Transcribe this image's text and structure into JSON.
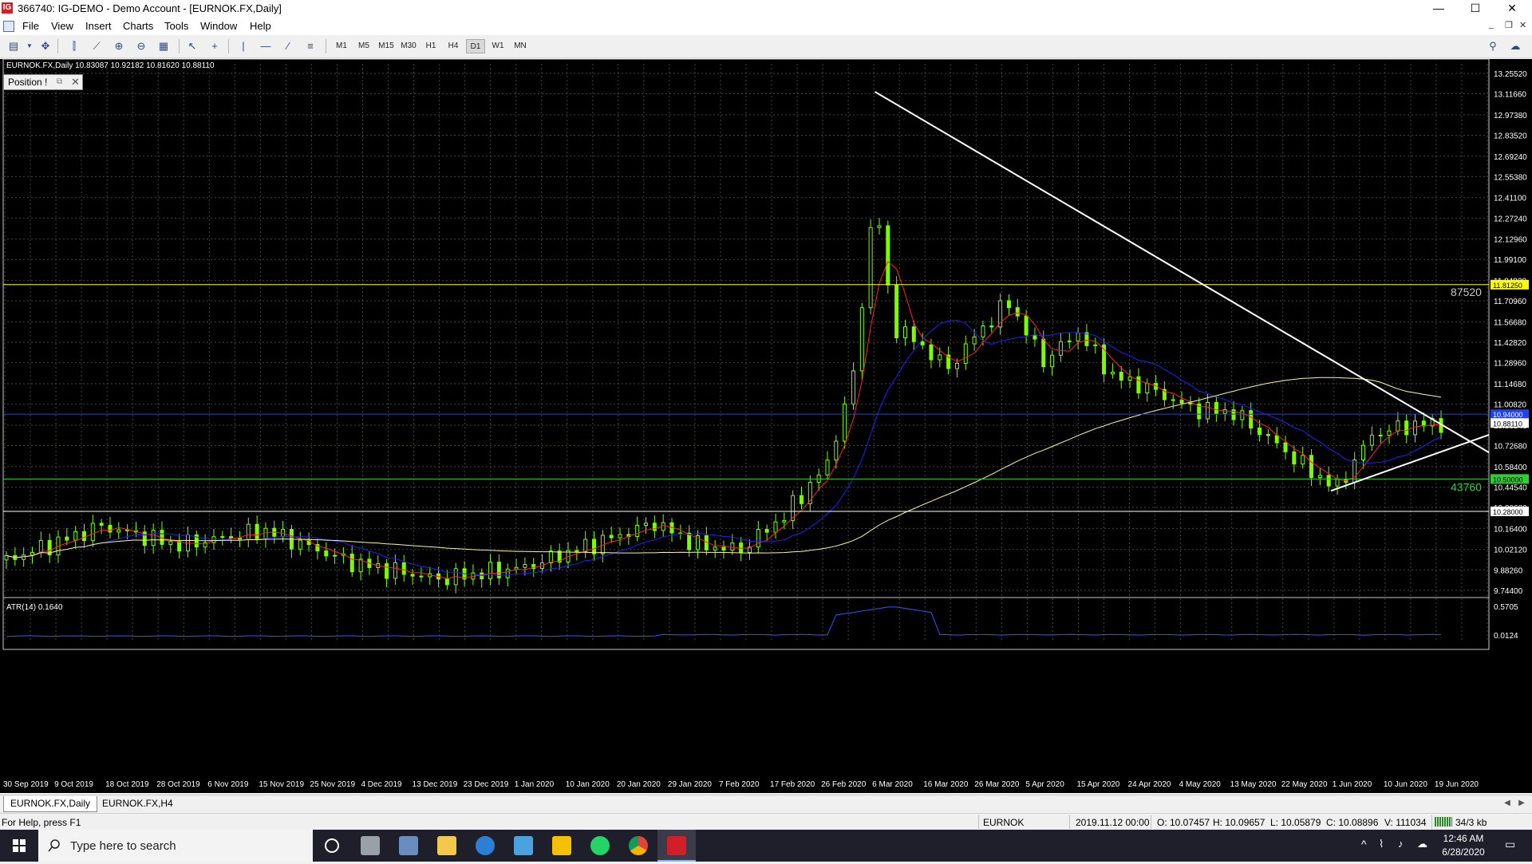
{
  "window": {
    "title": "366740: IG-DEMO - Demo Account - [EURNOK.FX,Daily]",
    "app_icon_text": "IG",
    "controls": {
      "minimize": "—",
      "maximize": "☐",
      "close": "✕"
    },
    "mdi_controls": {
      "minimize": "_",
      "restore": "❐",
      "close": "✕"
    }
  },
  "menu": [
    "File",
    "View",
    "Insert",
    "Charts",
    "Tools",
    "Window",
    "Help"
  ],
  "toolbar": {
    "timeframes": [
      "M1",
      "M5",
      "M15",
      "M30",
      "H1",
      "H4",
      "D1",
      "W1",
      "MN"
    ],
    "active_timeframe": "D1"
  },
  "chart": {
    "symbol_label": "EURNOK.FX,Daily  10.83087 10.92182 10.81620 10.88110",
    "position_panel_label": "Position !",
    "indicator_label": "ATR(14) 0.1640",
    "hline_labels": [
      "87520",
      "43760"
    ],
    "price_axis": [
      "13.25520",
      "13.11660",
      "12.97380",
      "12.83520",
      "12.69240",
      "12.55380",
      "12.41100",
      "12.27240",
      "12.12960",
      "11.99100",
      "11.84820",
      "11.70960",
      "11.56680",
      "11.42820",
      "11.28960",
      "11.14680",
      "11.00820",
      "10.86540",
      "10.72680",
      "10.58400",
      "10.44540",
      "10.30680",
      "10.16400",
      "10.02120",
      "9.88260",
      "9.74400"
    ],
    "price_badges": {
      "yellow": "11.81250",
      "current": "10.88110",
      "green": "10.50000",
      "white": "10.28000",
      "blue": "10.94000"
    },
    "atr_axis": [
      "0.5705",
      "0.0124"
    ],
    "date_axis": [
      "30 Sep 2019",
      "9 Oct 2019",
      "18 Oct 2019",
      "28 Oct 2019",
      "6 Nov 2019",
      "15 Nov 2019",
      "25 Nov 2019",
      "4 Dec 2019",
      "13 Dec 2019",
      "23 Dec 2019",
      "1 Jan 2020",
      "10 Jan 2020",
      "20 Jan 2020",
      "29 Jan 2020",
      "7 Feb 2020",
      "17 Feb 2020",
      "26 Feb 2020",
      "6 Mar 2020",
      "16 Mar 2020",
      "26 Mar 2020",
      "5 Apr 2020",
      "15 Apr 2020",
      "24 Apr 2020",
      "4 May 2020",
      "13 May 2020",
      "22 May 2020",
      "1 Jun 2020",
      "10 Jun 2020",
      "19 Jun 2020"
    ],
    "colors": {
      "background": "#000000",
      "candle": "#7cfc00",
      "grid": "#3a4a3a",
      "ma_red": "#ff2020",
      "ma_blue": "#2020ff",
      "ma_yellow": "#fff4a0",
      "trendline": "#ffffff",
      "hline_yellow": "#ffff00",
      "hline_green": "#32cd32",
      "hline_blue": "#1e40ff",
      "atr": "#3355ff"
    }
  },
  "tabs": [
    {
      "label": "EURNOK.FX,Daily",
      "active": true
    },
    {
      "label": "EURNOK.FX,H4",
      "active": false
    }
  ],
  "status": {
    "help": "For Help, press F1",
    "symbol": "EURNOK",
    "datetime": "2019.11.12 00:00",
    "open": "O: 10.07457",
    "high": "H: 10.09657",
    "low": "L: 10.05879",
    "close": "C: 10.08896",
    "volume": "V: 111034",
    "traffic": "34/3 kb"
  },
  "taskbar": {
    "search_placeholder": "Type here to search",
    "time": "12:46 AM",
    "date": "6/28/2020",
    "apps": [
      "cortana-icon",
      "task-view-icon",
      "app-icon",
      "file-explorer-icon",
      "edge-icon",
      "computer-icon",
      "sticky-icon",
      "whatsapp-icon",
      "chrome-icon",
      "ig-icon"
    ]
  }
}
